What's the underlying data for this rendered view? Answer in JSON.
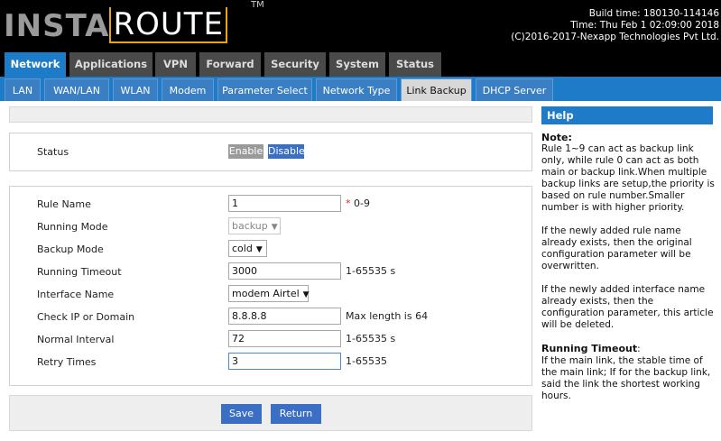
{
  "header": {
    "logo_part1": "INSTA",
    "logo_part2": "ROUTE",
    "logo_tm": "TM",
    "build_time": "Build time: 180130-114146",
    "time": "Time: Thu Feb 1 02:09:00 2018",
    "copyright": "(C)2016-2017-Nexapp Technologies Pvt Ltd."
  },
  "main_tabs": [
    {
      "label": "Network",
      "active": true
    },
    {
      "label": "Applications"
    },
    {
      "label": "VPN"
    },
    {
      "label": "Forward"
    },
    {
      "label": "Security"
    },
    {
      "label": "System"
    },
    {
      "label": "Status"
    }
  ],
  "sub_tabs": [
    {
      "label": "LAN"
    },
    {
      "label": "WAN/LAN"
    },
    {
      "label": "WLAN"
    },
    {
      "label": "Modem"
    },
    {
      "label": "Parameter Select"
    },
    {
      "label": "Network Type"
    },
    {
      "label": "Link Backup",
      "active": true
    },
    {
      "label": "DHCP Server"
    }
  ],
  "status": {
    "label": "Status",
    "enable_label": "Enable",
    "disable_label": "Disable",
    "selected": "Disable"
  },
  "form": {
    "rule_name": {
      "label": "Rule Name",
      "value": "1",
      "required_mark": "*",
      "hint": "0-9"
    },
    "running_mode": {
      "label": "Running Mode",
      "value": "backup"
    },
    "backup_mode": {
      "label": "Backup Mode",
      "value": "cold"
    },
    "running_timeout": {
      "label": "Running Timeout",
      "value": "3000",
      "hint": "1-65535 s"
    },
    "interface_name": {
      "label": "Interface Name",
      "value": "modem Airtel"
    },
    "check_ip": {
      "label": "Check IP or Domain",
      "value": "8.8.8.8",
      "hint": "Max length is 64"
    },
    "normal_interval": {
      "label": "Normal Interval",
      "value": "72",
      "hint": "1-65535 s"
    },
    "retry_times": {
      "label": "Retry Times",
      "value": "3",
      "hint": "1-65535"
    }
  },
  "buttons": {
    "save": "Save",
    "return": "Return"
  },
  "help": {
    "title": "Help",
    "note_title": "Note:",
    "note_p1": "Rule 1~9 can act as backup link only, while rule 0 can act as both main or backup link.When multiple backup links are setup,the priority is based on rule number.Smaller number is with higher priority.",
    "note_p2": "If the newly added rule name already exists, then the original configuration parameter will be overwritten.",
    "note_p3": "If the newly added interface name already exists, then the configuration parameter, this article will be deleted.",
    "rt_title": "Running Timeout",
    "rt_colon": ":",
    "rt_text": "If the main link, the stable time of the main link; If for the backup link, said the link the shortest working hours."
  },
  "colors": {
    "accent": "#1e7bc7",
    "button": "#3b6fc4",
    "logo_border": "#e9a21a"
  }
}
